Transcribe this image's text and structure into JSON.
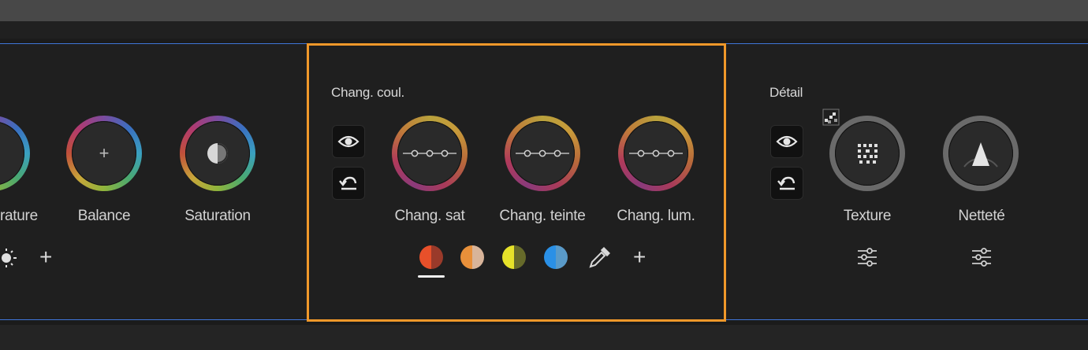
{
  "left_section": {
    "wheels": [
      {
        "label": "rature"
      },
      {
        "label": "Balance"
      },
      {
        "label": "Saturation"
      }
    ]
  },
  "color_shift": {
    "title": "Chang. coul.",
    "wheels": [
      {
        "label": "Chang. sat"
      },
      {
        "label": "Chang. teinte"
      },
      {
        "label": "Chang. lum."
      }
    ],
    "swatches": [
      {
        "name": "red",
        "left": "#e8502a",
        "right": "#9a3a2a",
        "selected": true
      },
      {
        "name": "orange",
        "left": "#e8903a",
        "right": "#d8b49a"
      },
      {
        "name": "yellow",
        "left": "#e6e22a",
        "right": "#666a2a"
      },
      {
        "name": "blue",
        "left": "#2a90e6",
        "right": "#5a9ac8"
      }
    ]
  },
  "detail": {
    "title": "Détail",
    "wheels": [
      {
        "label": "Texture"
      },
      {
        "label": "Netteté"
      }
    ]
  },
  "colors": {
    "highlight_border": "#f0982a",
    "panel_border": "#3f76d9",
    "panel_bg": "#1f1f1f"
  }
}
